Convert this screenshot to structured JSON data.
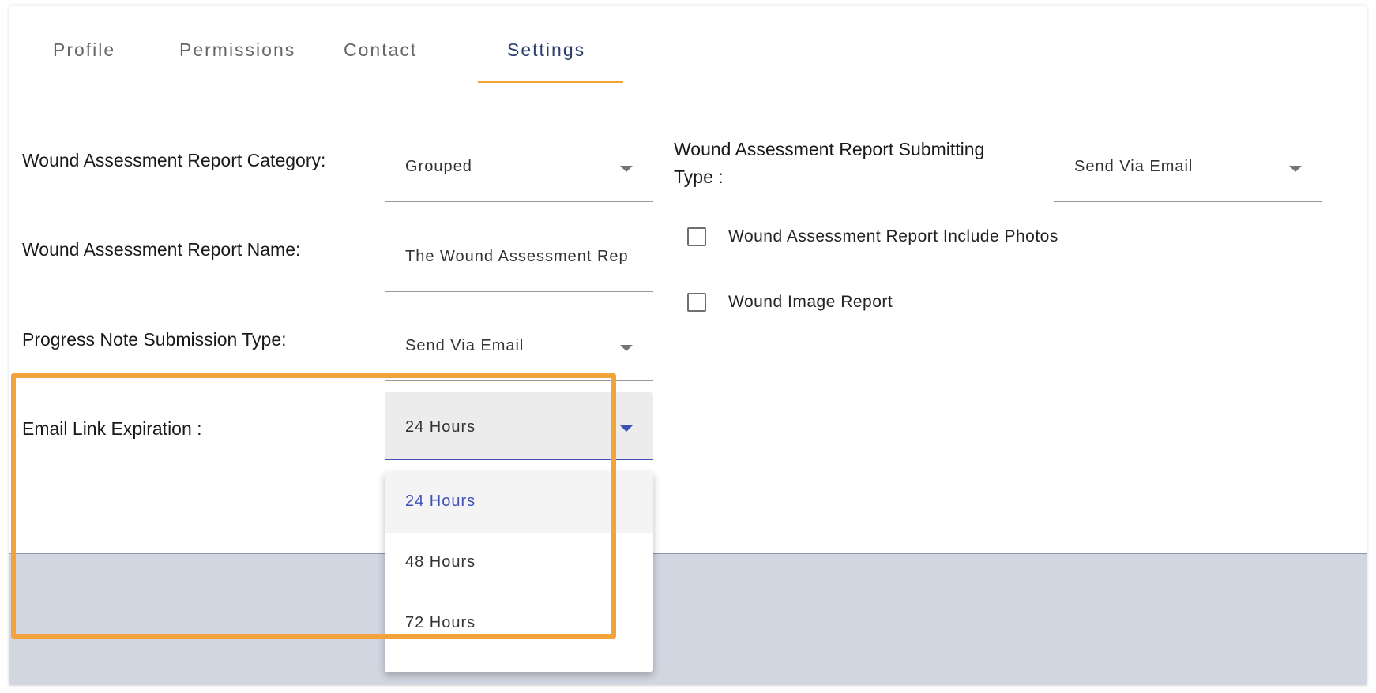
{
  "tabs": [
    {
      "label": "Profile"
    },
    {
      "label": "Permissions"
    },
    {
      "label": "Contact"
    },
    {
      "label": "Settings"
    }
  ],
  "form": {
    "category_label": "Wound Assessment Report Category:",
    "category_value": "Grouped",
    "report_name_label": "Wound Assessment Report Name:",
    "report_name_value": "The Wound Assessment Rep",
    "progress_note_label": "Progress Note Submission Type:",
    "progress_note_value": "Send Via Email",
    "email_expiration_label": "Email Link Expiration :",
    "email_expiration_value": "24 Hours",
    "submitting_type_label_line1": "Wound Assessment Report Submitting",
    "submitting_type_label_line2": "Type :",
    "submitting_type_value": "Send Via Email",
    "include_photos_label": "Wound Assessment Report Include Photos",
    "image_report_label": "Wound Image Report"
  },
  "dropdown": {
    "options": [
      {
        "label": "24 Hours"
      },
      {
        "label": "48 Hours"
      },
      {
        "label": "72 Hours"
      }
    ]
  },
  "colors": {
    "accent": "#f2a43a",
    "primary": "#3f51b5",
    "tab_active": "#2a3f6b",
    "bottom_band": "#d2d6e1"
  }
}
